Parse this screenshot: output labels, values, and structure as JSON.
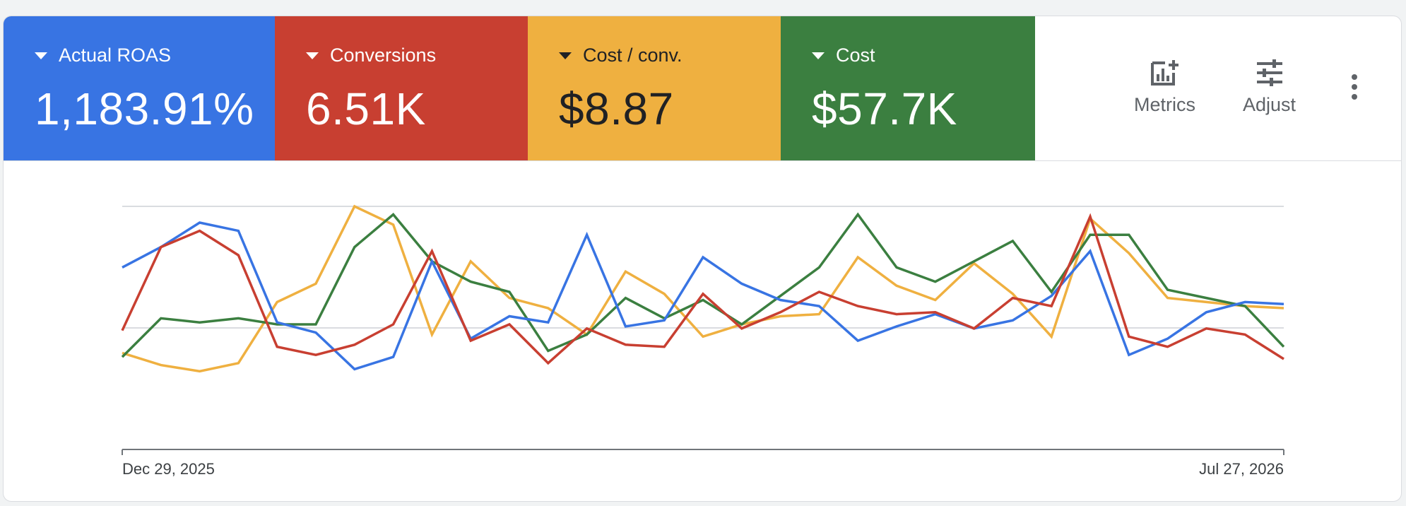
{
  "tiles": [
    {
      "id": "actual-roas",
      "label": "Actual ROAS",
      "value": "1,183.91%",
      "color": "#3874e3",
      "text": "light"
    },
    {
      "id": "conversions",
      "label": "Conversions",
      "value": "6.51K",
      "color": "#c83f31",
      "text": "light"
    },
    {
      "id": "cost-per-conv",
      "label": "Cost / conv.",
      "value": "$8.87",
      "color": "#efb040",
      "text": "dark"
    },
    {
      "id": "cost",
      "label": "Cost",
      "value": "$57.7K",
      "color": "#3b7f40",
      "text": "light"
    }
  ],
  "toolbar": {
    "metrics_label": "Metrics",
    "adjust_label": "Adjust",
    "metrics_icon": "add-chart-icon",
    "adjust_icon": "tune-sliders-icon",
    "more_icon": "more-vert-icon"
  },
  "chart_data": {
    "type": "line",
    "x_start_label": "Dec 29, 2025",
    "x_end_label": "Jul 27, 2026",
    "x": [
      "2025-12-29",
      "2026-01-05",
      "2026-01-12",
      "2026-01-19",
      "2026-01-26",
      "2026-02-02",
      "2026-02-09",
      "2026-02-16",
      "2026-02-23",
      "2026-03-02",
      "2026-03-09",
      "2026-03-16",
      "2026-03-23",
      "2026-03-30",
      "2026-04-06",
      "2026-04-13",
      "2026-04-20",
      "2026-04-27",
      "2026-05-04",
      "2026-05-11",
      "2026-05-18",
      "2026-05-25",
      "2026-06-01",
      "2026-06-08",
      "2026-06-15",
      "2026-06-22",
      "2026-06-29",
      "2026-07-06",
      "2026-07-13",
      "2026-07-20",
      "2026-07-27"
    ],
    "grid": true,
    "yaxis_labels": false,
    "normalized": true,
    "ylim": [
      0,
      100
    ],
    "series": [
      {
        "id": "actual-roas",
        "color": "#3874e3",
        "values": [
          70,
          80,
          92,
          88,
          43,
          38,
          20,
          26,
          73,
          35,
          46,
          43,
          86,
          41,
          44,
          75,
          62,
          54,
          51,
          34,
          41,
          47,
          40,
          44,
          56,
          78,
          27,
          35,
          48,
          53,
          52
        ]
      },
      {
        "id": "conversions",
        "color": "#c83f31",
        "values": [
          39,
          80,
          88,
          76,
          31,
          27,
          32,
          42,
          78,
          34,
          42,
          23,
          40,
          32,
          31,
          57,
          40,
          48,
          58,
          51,
          47,
          48,
          40,
          55,
          51,
          95,
          36,
          31,
          40,
          37,
          25
        ]
      },
      {
        "id": "cost-per-conv",
        "color": "#efb040",
        "values": [
          28,
          22,
          19,
          23,
          53,
          62,
          100,
          91,
          37,
          73,
          55,
          50,
          37,
          68,
          57,
          36,
          42,
          46,
          47,
          75,
          61,
          54,
          72,
          57,
          36,
          94,
          77,
          55,
          53,
          51,
          50
        ]
      },
      {
        "id": "cost",
        "color": "#3b7f40",
        "values": [
          26,
          45,
          43,
          45,
          42,
          42,
          80,
          96,
          73,
          63,
          58,
          29,
          37,
          55,
          45,
          54,
          42,
          56,
          70,
          96,
          70,
          63,
          73,
          83,
          58,
          86,
          86,
          59,
          55,
          51,
          31
        ]
      }
    ]
  }
}
